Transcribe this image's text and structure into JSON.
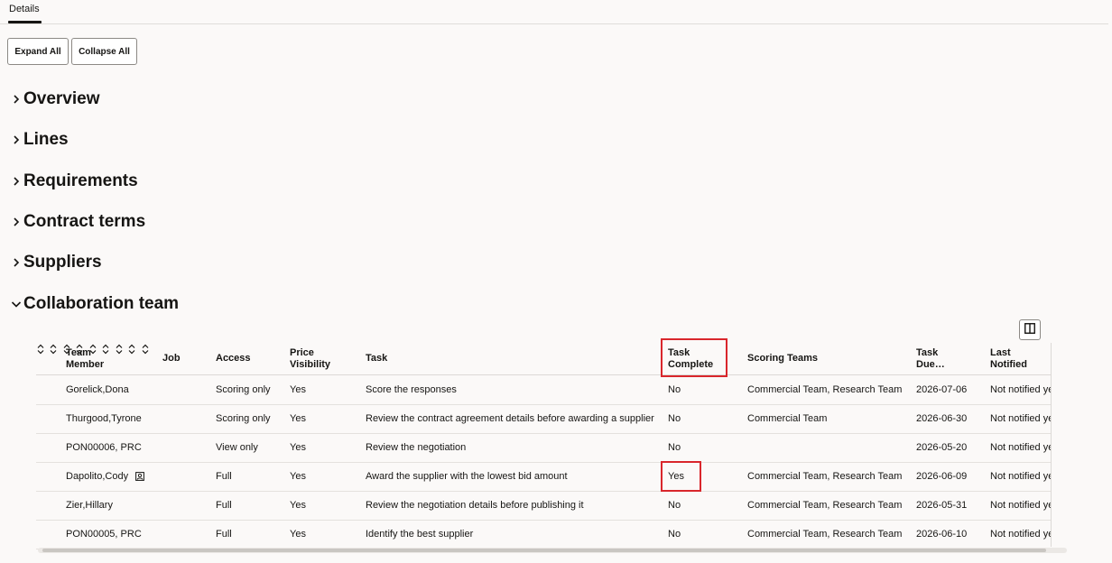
{
  "tabs": [
    {
      "label": "Details",
      "active": true
    }
  ],
  "toolbar": {
    "expand_label": "Expand All",
    "collapse_label": "Collapse All"
  },
  "sections": [
    {
      "title": "Overview",
      "expanded": false
    },
    {
      "title": "Lines",
      "expanded": false
    },
    {
      "title": "Requirements",
      "expanded": false
    },
    {
      "title": "Contract terms",
      "expanded": false
    },
    {
      "title": "Suppliers",
      "expanded": false
    },
    {
      "title": "Collaboration team",
      "expanded": true
    }
  ],
  "table": {
    "columns": [
      {
        "line1": "Team",
        "line2": "Member",
        "sortable": true
      },
      {
        "line1": "Job",
        "line2": "",
        "sortable": true
      },
      {
        "line1": "Access",
        "line2": "",
        "sortable": true
      },
      {
        "line1": "Price",
        "line2": "Visibility",
        "sortable": true
      },
      {
        "line1": "Task",
        "line2": "",
        "sortable": true
      },
      {
        "line1": "Task",
        "line2": "Complete",
        "sortable": true
      },
      {
        "line1": "Scoring Teams",
        "line2": "",
        "sortable": true
      },
      {
        "line1": "Task",
        "line2": "Due…",
        "sortable": true
      },
      {
        "line1": "Last",
        "line2": "Notified",
        "sortable": true
      }
    ],
    "rows": [
      {
        "member": "Gorelick,Dona",
        "job": "",
        "access": "Scoring only",
        "price_visibility": "Yes",
        "task": "Score the responses",
        "task_complete": "No",
        "scoring_teams": "Commercial Team, Research Team",
        "task_due": "2026-07-06",
        "last_notified": "Not notified yet"
      },
      {
        "member": "Thurgood,Tyrone",
        "job": "",
        "access": "Scoring only",
        "price_visibility": "Yes",
        "task": "Review the contract agreement details before awarding a supplier",
        "task_complete": "No",
        "scoring_teams": "Commercial Team",
        "task_due": "2026-06-30",
        "last_notified": "Not notified yet"
      },
      {
        "member": "PON00006, PRC",
        "job": "",
        "access": "View only",
        "price_visibility": "Yes",
        "task": "Review the negotiation",
        "task_complete": "No",
        "scoring_teams": "",
        "task_due": "2026-05-20",
        "last_notified": "Not notified yet"
      },
      {
        "member": "Dapolito,Cody",
        "job": "",
        "access": "Full",
        "price_visibility": "Yes",
        "task": "Award the supplier with the lowest bid amount",
        "task_complete": "Yes",
        "scoring_teams": "Commercial Team, Research Team",
        "task_due": "2026-06-09",
        "last_notified": "Not notified yet",
        "has_person_icon": true
      },
      {
        "member": "Zier,Hillary",
        "job": "",
        "access": "Full",
        "price_visibility": "Yes",
        "task": "Review the negotiation details before publishing it",
        "task_complete": "No",
        "scoring_teams": "Commercial Team, Research Team",
        "task_due": "2026-05-31",
        "last_notified": "Not notified yet"
      },
      {
        "member": "PON00005, PRC",
        "job": "",
        "access": "Full",
        "price_visibility": "Yes",
        "task": "Identify the best supplier",
        "task_complete": "No",
        "scoring_teams": "Commercial Team, Research Team",
        "task_due": "2026-06-10",
        "last_notified": "Not notified yet"
      }
    ]
  },
  "highlight_color": "#d9262c"
}
